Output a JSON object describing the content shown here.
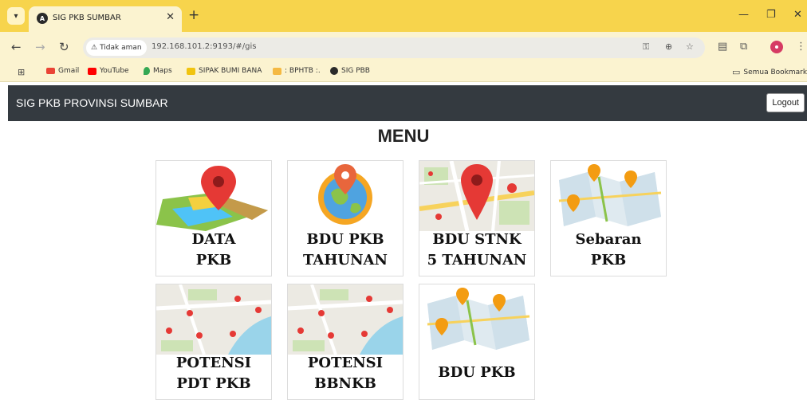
{
  "browser": {
    "tab_title": "SIG PKB SUMBAR",
    "secure_label": "Tidak aman",
    "url": "192.168.101.2:9193/#/gis",
    "bookmarks": [
      "Gmail",
      "YouTube",
      "Maps",
      "SIPAK BUMI BANA",
      ": BPHTB :.",
      "SIG PBB"
    ],
    "all_bookmarks": "Semua Bookmark"
  },
  "app": {
    "brand": "SIG PKB PROVINSI SUMBAR",
    "logout_label": "Logout",
    "menu_title": "MENU"
  },
  "menu_cards": [
    {
      "line1": "DATA",
      "line2": "PKB",
      "icon": "map-pin-icon"
    },
    {
      "line1": "BDU PKB",
      "line2": "TAHUNAN",
      "icon": "globe-pin-icon"
    },
    {
      "line1": "BDU STNK",
      "line2": "5 TAHUNAN",
      "icon": "city-map-icon"
    },
    {
      "line1": "Sebaran",
      "line2": "PKB",
      "icon": "folded-map-icon"
    },
    {
      "line1": "POTENSI",
      "line2": "PDT PKB",
      "icon": "city-map-icon"
    },
    {
      "line1": "POTENSI",
      "line2": "BBNKB",
      "icon": "city-map-icon"
    },
    {
      "line1": "BDU PKB",
      "line2": "",
      "icon": "folded-map-icon"
    }
  ],
  "colors": {
    "titlebar": "#f7d44c",
    "navbar": "#343a40",
    "pin_red": "#e53935",
    "pin_orange": "#f39c12"
  }
}
